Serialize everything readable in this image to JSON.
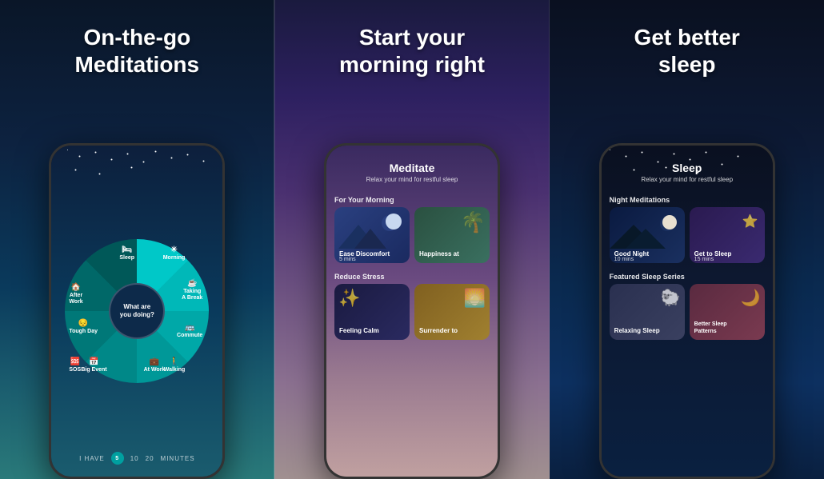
{
  "panels": [
    {
      "id": "panel-1",
      "title": "On-the-go\nMeditations",
      "phone": {
        "wheel": {
          "center_text": "What are\nyou doing?",
          "labels": [
            "Sleep",
            "Morning",
            "Taking\nA Break",
            "Commute",
            "Walking",
            "At Work",
            "Big Event",
            "SOS",
            "Tough Day",
            "After\nWork"
          ],
          "icons": [
            "🛏",
            "☀",
            "☕",
            "🚌",
            "🚶",
            "💼",
            "📅",
            "🆘",
            "😔",
            "🏠"
          ]
        },
        "minutes": {
          "prefix": "I HAVE",
          "values": [
            "5",
            "10",
            "20"
          ],
          "suffix": "MINUTES"
        }
      }
    },
    {
      "id": "panel-2",
      "title": "Start your\nmorning right",
      "phone": {
        "header": {
          "title": "Meditate",
          "subtitle": "Relax your mind for restful sleep"
        },
        "sections": [
          {
            "label": "For Your Morning",
            "cards": [
              {
                "title": "Ease Discomfort",
                "duration": "5 mins",
                "color": "blue"
              },
              {
                "title": "Happiness at",
                "duration": "",
                "color": "green"
              }
            ]
          },
          {
            "label": "Reduce Stress",
            "cards": [
              {
                "title": "Feeling Calm",
                "duration": "",
                "color": "dark"
              },
              {
                "title": "Surrender to",
                "duration": "",
                "color": "orange"
              }
            ]
          }
        ]
      }
    },
    {
      "id": "panel-3",
      "title": "Get better\nsleep",
      "phone": {
        "header": {
          "title": "Sleep",
          "subtitle": "Relax your mind for restful sleep"
        },
        "sections": [
          {
            "label": "Night Meditations",
            "cards": [
              {
                "title": "Good Night",
                "duration": "10 mins",
                "color": "night"
              },
              {
                "title": "Get to Sleep",
                "duration": "15 mins",
                "color": "purple"
              }
            ]
          },
          {
            "label": "Featured Sleep Series",
            "cards": [
              {
                "title": "Relaxing Sleep",
                "duration": "",
                "color": "sheep"
              },
              {
                "title": "Better Sleep\nPatterns",
                "duration": "",
                "color": "pink"
              }
            ]
          }
        ]
      }
    }
  ]
}
